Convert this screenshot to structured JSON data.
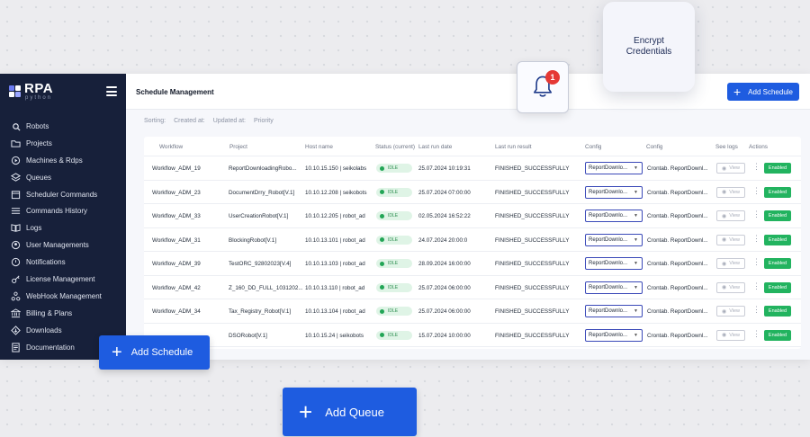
{
  "app": {
    "logo_text": "RPA",
    "logo_sub": "python",
    "colors": {
      "sidebar": "#17203a",
      "accent": "#1e5ce0",
      "enabled": "#22b35f",
      "idle": "#22a556",
      "badge": "#e53935"
    }
  },
  "sidebar": {
    "items": [
      {
        "label": "Robots",
        "icon": "robot-icon"
      },
      {
        "label": "Projects",
        "icon": "folder-icon"
      },
      {
        "label": "Machines & Rdps",
        "icon": "machine-icon"
      },
      {
        "label": "Queues",
        "icon": "layers-icon"
      },
      {
        "label": "Scheduler Commands",
        "icon": "calendar-icon"
      },
      {
        "label": "Commands History",
        "icon": "list-icon"
      },
      {
        "label": "Logs",
        "icon": "book-icon"
      },
      {
        "label": "User Managements",
        "icon": "users-icon"
      },
      {
        "label": "Notifications",
        "icon": "bell-icon"
      },
      {
        "label": "License Management",
        "icon": "key-icon"
      },
      {
        "label": "WebHook Management",
        "icon": "webhook-icon"
      },
      {
        "label": "Billing & Plans",
        "icon": "bank-icon"
      },
      {
        "label": "Downloads",
        "icon": "download-icon"
      },
      {
        "label": "Documentation",
        "icon": "document-icon"
      }
    ]
  },
  "header": {
    "title": "Schedule Management",
    "add_schedule_label": "Add Schedule"
  },
  "sorting": {
    "label": "Sorting:",
    "options": [
      "Created at:",
      "Updated at:",
      "Priority"
    ]
  },
  "table": {
    "columns": [
      "Workflow",
      "Project",
      "Host name",
      "Status (current)",
      "Last run date",
      "Last run result",
      "Config",
      "Config",
      "See logs",
      "Actions"
    ],
    "view_label": "View",
    "enabled_label": "Enabled",
    "rows": [
      {
        "workflow": "Workflow_ADM_19",
        "project": "ReportDownloadingRobo...",
        "host": "10.10.15.150 | seikolabs",
        "status": "IDLE",
        "last_run": "25.07.2024 10:19:31",
        "result": "FINISHED_SUCCESSFULLY",
        "config": "ReportDownlo...",
        "cron": "Crontab. ReportDownl..."
      },
      {
        "workflow": "Workflow_ADM_23",
        "project": "DocumentDrry_Robot[V.1]",
        "host": "10.10.12.208 | seikobots",
        "status": "IDLE",
        "last_run": "25.07.2024 07:00:00",
        "result": "FINISHED_SUCCESSFULLY",
        "config": "ReportDownlo...",
        "cron": "Crontab. ReportDownl..."
      },
      {
        "workflow": "Workflow_ADM_33",
        "project": "UserCreationRobot[V.1]",
        "host": "10.10.12.205 | robot_ad",
        "status": "IDLE",
        "last_run": "02.05.2024 16:52:22",
        "result": "FINISHED_SUCCESSFULLY",
        "config": "ReportDownlo...",
        "cron": "Crontab. ReportDownl..."
      },
      {
        "workflow": "Workflow_ADM_31",
        "project": "BlockingRobot[V.1]",
        "host": "10.10.13.101 | robot_ad",
        "status": "IDLE",
        "last_run": "24.07.2024 20:00:0",
        "result": "FINISHED_SUCCESSFULLY",
        "config": "ReportDownlo...",
        "cron": "Crontab. ReportDownl..."
      },
      {
        "workflow": "Workflow_ADM_39",
        "project": "TestORC_92802023[V.4]",
        "host": "10.10.13.103 | robot_ad",
        "status": "IDLE",
        "last_run": "28.09.2024 16:00:00",
        "result": "FINISHED_SUCCESSFULLY",
        "config": "ReportDownlo...",
        "cron": "Crontab. ReportDownl..."
      },
      {
        "workflow": "Workflow_ADM_42",
        "project": "Z_160_DD_FULL_1031202...",
        "host": "10.10.13.110 | robot_ad",
        "status": "IDLE",
        "last_run": "25.07.2024 06:00:00",
        "result": "FINISHED_SUCCESSFULLY",
        "config": "ReportDownlo...",
        "cron": "Crontab. ReportDownl..."
      },
      {
        "workflow": "Workflow_ADM_34",
        "project": "Tax_Registry_Robot[V.1]",
        "host": "10.10.13.104 | robot_ad",
        "status": "IDLE",
        "last_run": "25.07.2024 06:00:00",
        "result": "FINISHED_SUCCESSFULLY",
        "config": "ReportDownlo...",
        "cron": "Crontab. ReportDownl..."
      },
      {
        "workflow": "",
        "project": "DSORobot[V.1]",
        "host": "10.10.15.24 | seikobots",
        "status": "IDLE",
        "last_run": "15.07.2024 10:00:00",
        "result": "FINISHED_SUCCESSFULLY",
        "config": "ReportDownlo...",
        "cron": "Crontab. ReportDownl..."
      }
    ]
  },
  "floating": {
    "notification_count": "1",
    "encrypt_line1": "Encrypt",
    "encrypt_line2": "Credentials",
    "add_schedule_label": "Add Schedule",
    "add_queue_label": "Add Queue"
  }
}
